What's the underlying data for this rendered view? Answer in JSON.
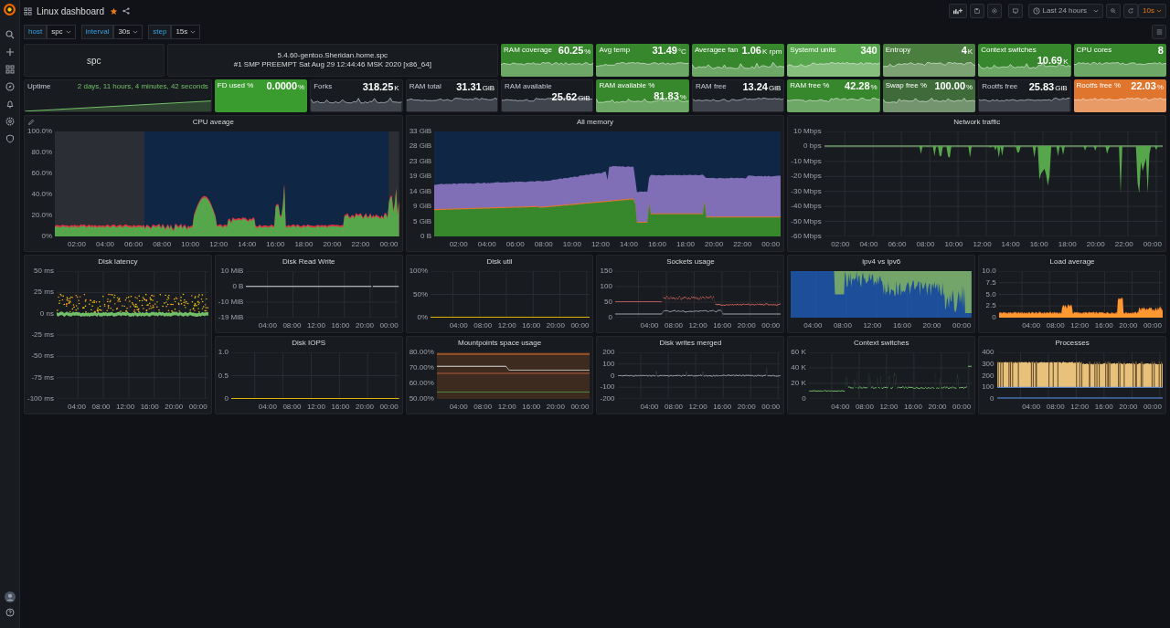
{
  "top_bar": {
    "title": "Linux dashboard",
    "starred": true,
    "time_range": "Last 24 hours",
    "refresh": "10s"
  },
  "variables": [
    {
      "label": "host",
      "value": "spc"
    },
    {
      "label": "interval",
      "value": "30s"
    },
    {
      "label": "step",
      "value": "15s"
    }
  ],
  "hostname_panel": {
    "text": "spc"
  },
  "kernel_panel": {
    "lines": [
      "5.4.60-gentoo.Sheridan.home.spc",
      "#1 SMP PREEMPT Sat Aug 29 12:44:46 MSK 2020 [x86_64]"
    ]
  },
  "stats_row_1": [
    {
      "title": "RAM coverage",
      "value": "60.25",
      "unit": "%",
      "color": "#37872d",
      "sparkline": true
    },
    {
      "title": "Avg temp",
      "value": "31.49",
      "unit": "°C",
      "color": "#37872d",
      "sparkline": true
    },
    {
      "title": "Averagee fan",
      "value": "1.06",
      "unit": "K rpm",
      "color": "#37872d",
      "sparkline": true
    },
    {
      "title": "Systemd units",
      "value": "340",
      "color": "#56a64b",
      "sparkline": true
    },
    {
      "title": "Entropy",
      "value": "4",
      "unit": "K",
      "color": "#4a7f3f",
      "sparkline": true
    },
    {
      "title": "Context switches",
      "value": "10.69",
      "unit": "K",
      "color": "#37872d",
      "sparkline": true
    },
    {
      "title": "CPU cores",
      "value": "8",
      "color": "#37872d",
      "sparkline": true
    }
  ],
  "uptime": {
    "title": "Uptime",
    "value": "2 days, 11 hours, 4 minutes, 42 seconds"
  },
  "stats_row_2": [
    {
      "title": "FD used %",
      "value": "0.0000",
      "unit": "%",
      "color": "#3a9b2f",
      "sparkline": false
    },
    {
      "title": "Forks",
      "value": "318.25",
      "unit": "K",
      "sparkline": true
    },
    {
      "title": "RAM total",
      "value": "31.31",
      "unit": "GiB",
      "sparkline": true
    },
    {
      "title": "RAM available",
      "value": "25.62",
      "unit": "GiB",
      "sparkline": true
    },
    {
      "title": "RAM available %",
      "value": "81.83",
      "unit": "%",
      "color": "#37872d",
      "sparkline": true
    },
    {
      "title": "RAM free",
      "value": "13.24",
      "unit": "GiB",
      "sparkline": true
    },
    {
      "title": "RAM free %",
      "value": "42.28",
      "unit": "%",
      "color": "#37872d",
      "sparkline": true
    },
    {
      "title": "Swap free %",
      "value": "100.00",
      "unit": "%",
      "color": "#3f6b3a",
      "sparkline": true
    },
    {
      "title": "Rootfs free",
      "value": "25.83",
      "unit": "GiB",
      "sparkline": true
    },
    {
      "title": "Rootfs free %",
      "value": "22.03",
      "unit": "%",
      "color": "#e0752d",
      "sparkline": true
    }
  ],
  "charts": [
    {
      "title": "CPU aveage",
      "kind": "cpu",
      "y_labels": [
        "100.0%",
        "80.0%",
        "60.0%",
        "40.0%",
        "20.0%",
        "0%"
      ],
      "x_labels": [
        "02:00",
        "04:00",
        "06:00",
        "08:00",
        "10:00",
        "12:00",
        "14:00",
        "16:00",
        "18:00",
        "20:00",
        "22:00",
        "00:00"
      ]
    },
    {
      "title": "All memory",
      "kind": "memory",
      "y_labels": [
        "33 GiB",
        "28 GiB",
        "23 GiB",
        "19 GiB",
        "14 GiB",
        "9 GiB",
        "5 GiB",
        "0 B"
      ],
      "x_labels": [
        "02:00",
        "04:00",
        "06:00",
        "08:00",
        "10:00",
        "12:00",
        "14:00",
        "16:00",
        "18:00",
        "20:00",
        "22:00",
        "00:00"
      ]
    },
    {
      "title": "Network traffic",
      "kind": "network",
      "y_labels": [
        "10 Mbps",
        "0 bps",
        "-10 Mbps",
        "-20 Mbps",
        "-30 Mbps",
        "-40 Mbps",
        "-50 Mbps",
        "-60 Mbps"
      ],
      "x_labels": [
        "02:00",
        "04:00",
        "06:00",
        "08:00",
        "10:00",
        "12:00",
        "14:00",
        "16:00",
        "18:00",
        "20:00",
        "22:00",
        "00:00"
      ]
    }
  ],
  "small_charts": [
    {
      "title": "Disk latency",
      "kind": "scatter",
      "y_labels": [
        "50 ms",
        "25 ms",
        "0 ns",
        "-25 ms",
        "-50 ms",
        "-75 ms",
        "-100 ms"
      ],
      "x_labels": [
        "04:00",
        "08:00",
        "12:00",
        "16:00",
        "20:00",
        "00:00"
      ]
    },
    {
      "title": "Disk Read Write",
      "kind": "flat_mid",
      "y_labels": [
        "10 MiB",
        "0 B",
        "-10 MiB",
        "-19 MiB"
      ],
      "x_labels": [
        "04:00",
        "08:00",
        "12:00",
        "16:00",
        "20:00",
        "00:00"
      ]
    },
    {
      "title": "Disk util",
      "kind": "flat_low",
      "y_labels": [
        "100%",
        "50%",
        "0%"
      ],
      "x_labels": [
        "04:00",
        "08:00",
        "12:00",
        "16:00",
        "20:00",
        "00:00"
      ]
    },
    {
      "title": "Sockets usage",
      "kind": "sockets",
      "y_labels": [
        "150",
        "100",
        "50",
        "0"
      ],
      "x_labels": [
        "04:00",
        "08:00",
        "12:00",
        "16:00",
        "20:00",
        "00:00"
      ]
    },
    {
      "title": "ipv4 vs ipv6",
      "kind": "ipv",
      "x_labels": [
        "04:00",
        "08:00",
        "12:00",
        "16:00",
        "20:00",
        "00:00"
      ]
    },
    {
      "title": "Load average",
      "kind": "load",
      "y_labels": [
        "10.0",
        "7.5",
        "5.0",
        "2.5",
        "0"
      ],
      "x_labels": [
        "04:00",
        "08:00",
        "12:00",
        "16:00",
        "20:00",
        "00:00"
      ]
    },
    {
      "title": "Disk IOPS",
      "kind": "flat_low",
      "y_labels": [
        "1.0",
        "0.5",
        "0"
      ],
      "x_labels": [
        "04:00",
        "08:00",
        "12:00",
        "16:00",
        "20:00",
        "00:00"
      ]
    },
    {
      "title": "Mountpoints space usage",
      "kind": "mount",
      "y_labels": [
        "80.00%",
        "70.00%",
        "60.00%",
        "50.00%"
      ],
      "x_labels": [
        "04:00",
        "08:00",
        "12:00",
        "16:00",
        "20:00",
        "00:00"
      ]
    },
    {
      "title": "Disk writes merged",
      "kind": "merged",
      "y_labels": [
        "200",
        "100",
        "0",
        "-100",
        "-200"
      ],
      "x_labels": [
        "04:00",
        "08:00",
        "12:00",
        "16:00",
        "20:00",
        "00:00"
      ]
    },
    {
      "title": "Context switches",
      "kind": "ctx",
      "y_labels": [
        "60 K",
        "40 K",
        "20 K",
        "0"
      ],
      "x_labels": [
        "04:00",
        "08:00",
        "12:00",
        "16:00",
        "20:00",
        "00:00"
      ]
    },
    {
      "title": "Processes",
      "kind": "procs",
      "y_labels": [
        "400",
        "300",
        "200",
        "100",
        "0"
      ],
      "x_labels": [
        "04:00",
        "08:00",
        "12:00",
        "16:00",
        "20:00",
        "00:00"
      ]
    }
  ]
}
